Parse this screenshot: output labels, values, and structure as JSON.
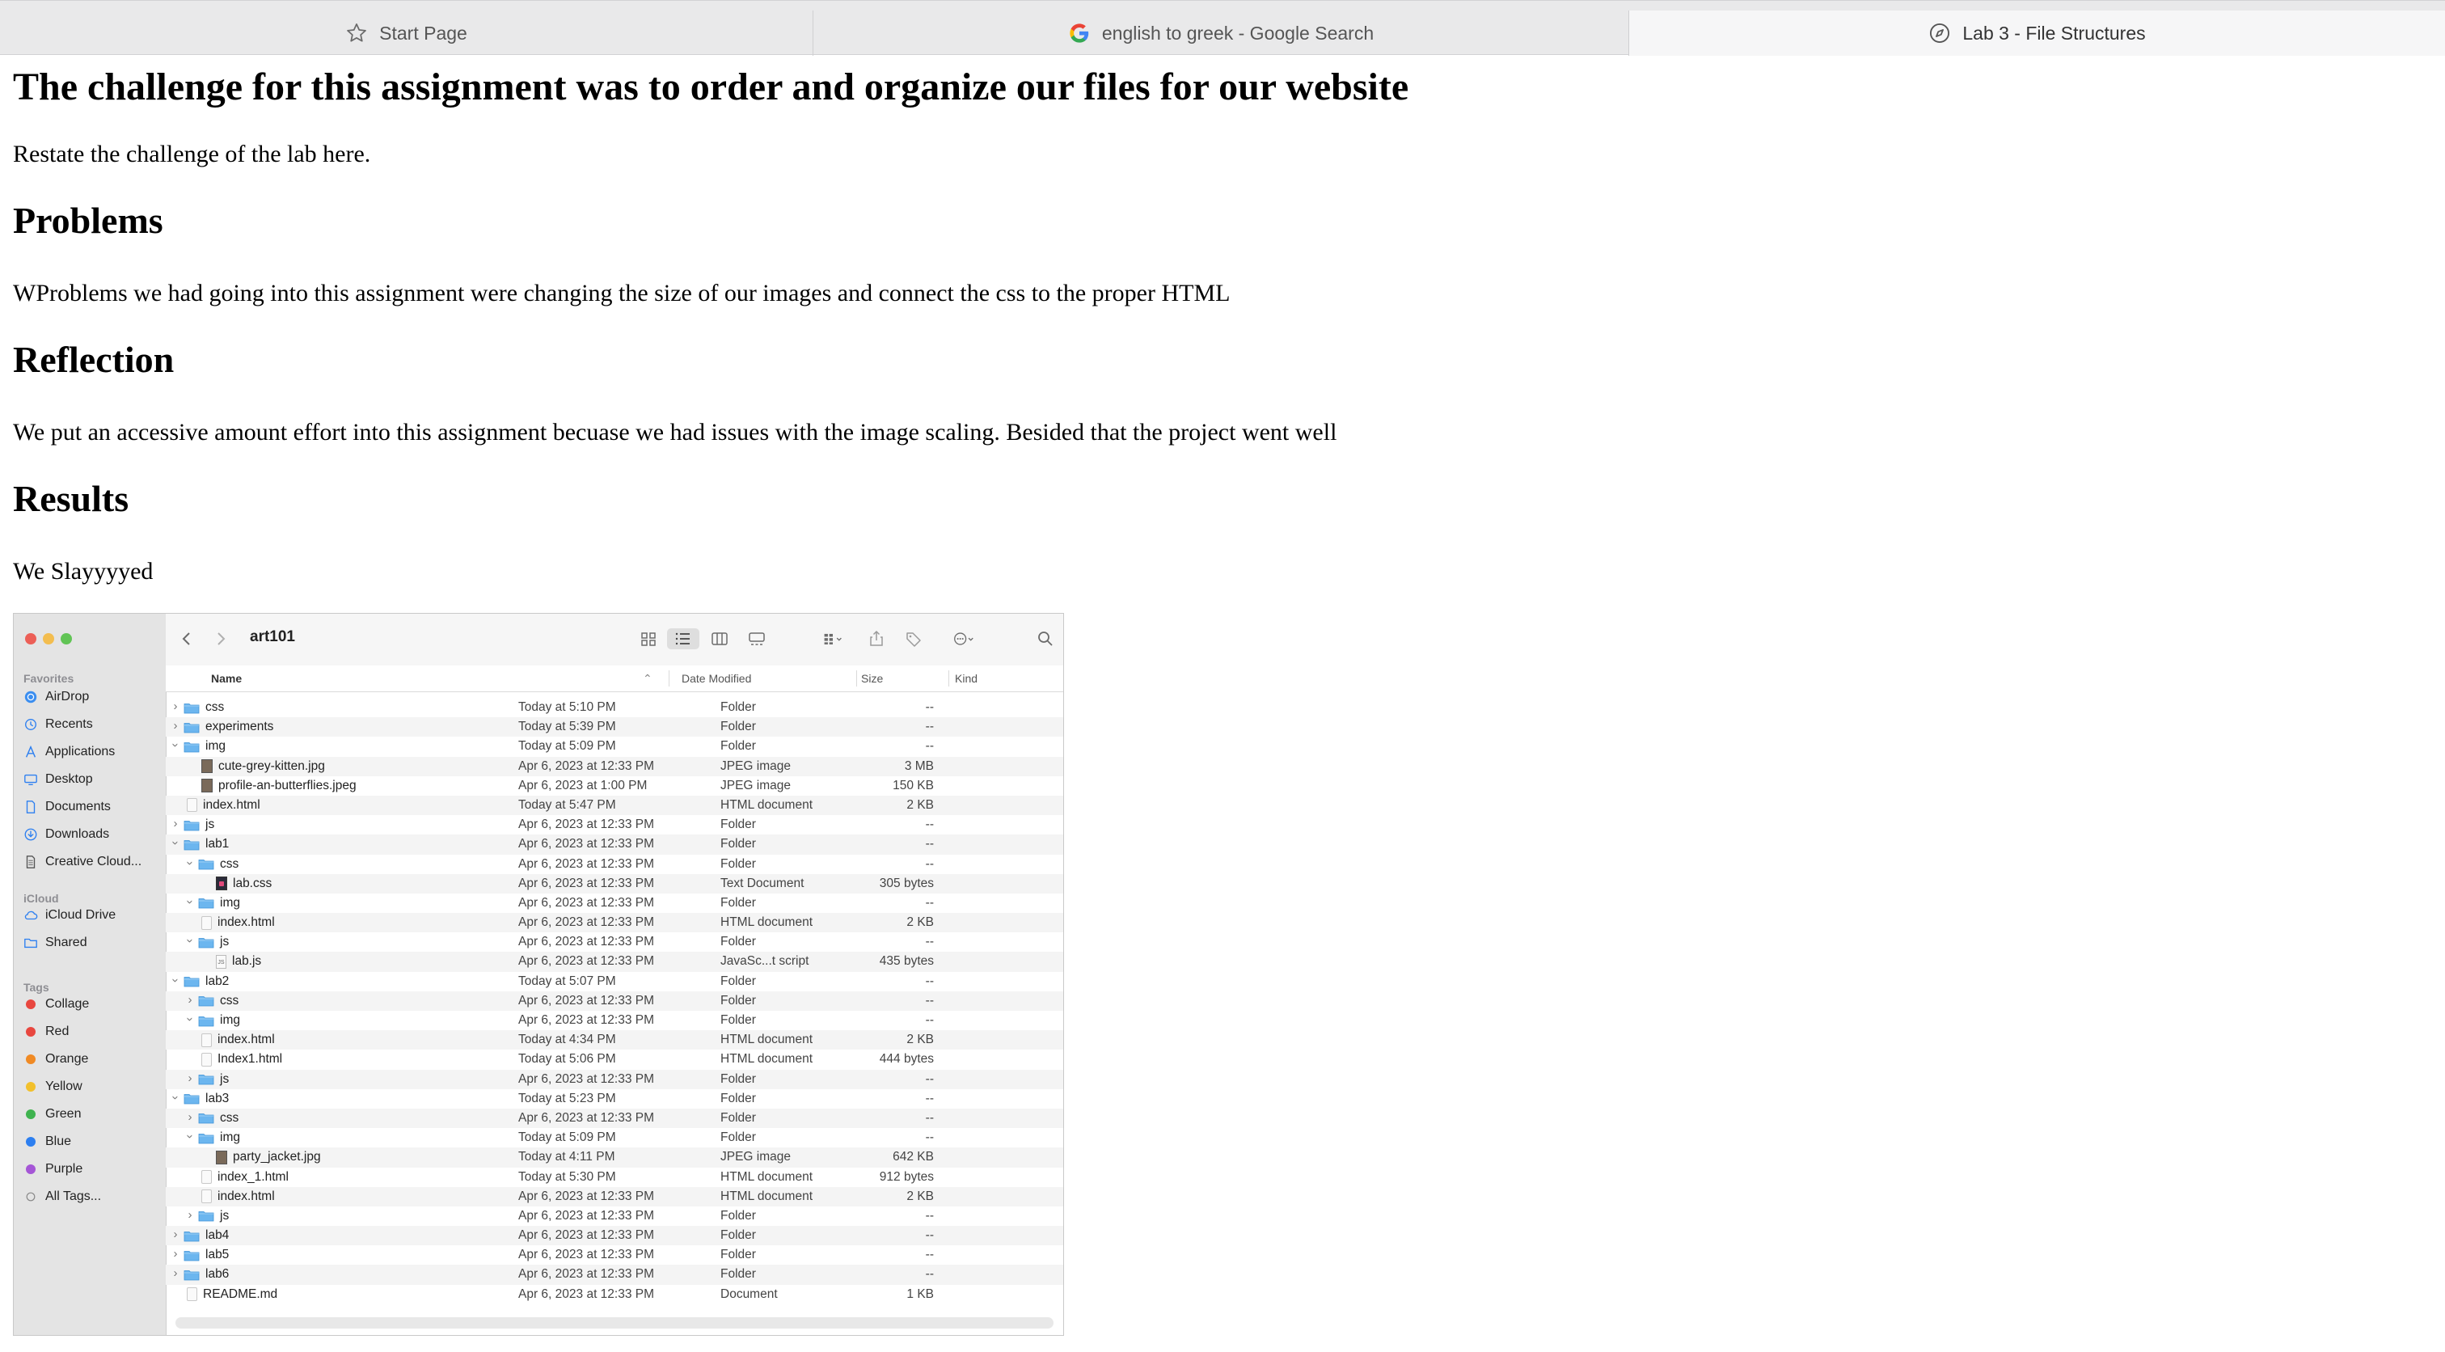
{
  "browser": {
    "tabs": [
      {
        "label": "Start Page",
        "icon": "star-icon"
      },
      {
        "label": "english to greek - Google Search",
        "icon": "google-icon"
      },
      {
        "label": "Lab 3 - File Structures",
        "icon": "compass-icon"
      }
    ]
  },
  "document": {
    "heading": "The challenge for this assignment was to order and organize our files for our website",
    "intro": "Restate the challenge of the lab here.",
    "problems_heading": "Problems",
    "problems_text": "WProblems we had going into this assignment were changing the size of our images and connect the css to the proper HTML",
    "reflection_heading": "Reflection",
    "reflection_text": "We put an accessive amount effort into this assignment becuase we had issues with the image scaling. Besided that the project went well",
    "results_heading": "Results",
    "results_text": "We Slayyyyed"
  },
  "finder": {
    "title": "art101",
    "sidebar": {
      "favorites_label": "Favorites",
      "favorites": [
        {
          "label": "AirDrop",
          "icon": "airdrop-icon"
        },
        {
          "label": "Recents",
          "icon": "clock-icon"
        },
        {
          "label": "Applications",
          "icon": "applications-icon"
        },
        {
          "label": "Desktop",
          "icon": "desktop-icon"
        },
        {
          "label": "Documents",
          "icon": "document-icon"
        },
        {
          "label": "Downloads",
          "icon": "download-icon"
        },
        {
          "label": "Creative Cloud...",
          "icon": "file-icon"
        }
      ],
      "icloud_label": "iCloud",
      "icloud": [
        {
          "label": "iCloud Drive",
          "icon": "cloud-icon"
        },
        {
          "label": "Shared",
          "icon": "shared-folder-icon"
        }
      ],
      "tags_label": "Tags",
      "tags": [
        {
          "label": "Collage",
          "color": "#e8473f"
        },
        {
          "label": "Red",
          "color": "#e8473f"
        },
        {
          "label": "Orange",
          "color": "#f08a24"
        },
        {
          "label": "Yellow",
          "color": "#f2c02c"
        },
        {
          "label": "Green",
          "color": "#3fb34f"
        },
        {
          "label": "Blue",
          "color": "#2d7ff0"
        },
        {
          "label": "Purple",
          "color": "#a556d6"
        },
        {
          "label": "All Tags...",
          "color": ""
        }
      ]
    },
    "columns": {
      "name": "Name",
      "date": "Date Modified",
      "size": "Size",
      "kind": "Kind"
    },
    "rows": [
      {
        "name": "css",
        "depth": 0,
        "type": "folder",
        "exp": "closed",
        "date": "Today at 5:10 PM",
        "size": "--",
        "kind": "Folder"
      },
      {
        "name": "experiments",
        "depth": 0,
        "type": "folder",
        "exp": "closed",
        "date": "Today at 5:39 PM",
        "size": "--",
        "kind": "Folder"
      },
      {
        "name": "img",
        "depth": 0,
        "type": "folder",
        "exp": "open",
        "date": "Today at 5:09 PM",
        "size": "--",
        "kind": "Folder"
      },
      {
        "name": "cute-grey-kitten.jpg",
        "depth": 1,
        "type": "image",
        "exp": "",
        "date": "Apr 6, 2023 at 12:33 PM",
        "size": "3 MB",
        "kind": "JPEG image"
      },
      {
        "name": "profile-an-butterflies.jpeg",
        "depth": 1,
        "type": "image",
        "exp": "",
        "date": "Apr 6, 2023 at 1:00 PM",
        "size": "150 KB",
        "kind": "JPEG image"
      },
      {
        "name": "index.html",
        "depth": 0,
        "type": "file",
        "exp": "",
        "date": "Today at 5:47 PM",
        "size": "2 KB",
        "kind": "HTML document"
      },
      {
        "name": "js",
        "depth": 0,
        "type": "folder",
        "exp": "closed",
        "date": "Apr 6, 2023 at 12:33 PM",
        "size": "--",
        "kind": "Folder"
      },
      {
        "name": "lab1",
        "depth": 0,
        "type": "folder",
        "exp": "open",
        "date": "Apr 6, 2023 at 12:33 PM",
        "size": "--",
        "kind": "Folder"
      },
      {
        "name": "css",
        "depth": 1,
        "type": "folder",
        "exp": "open",
        "date": "Apr 6, 2023 at 12:33 PM",
        "size": "--",
        "kind": "Folder"
      },
      {
        "name": "lab.css",
        "depth": 2,
        "type": "css",
        "exp": "",
        "date": "Apr 6, 2023 at 12:33 PM",
        "size": "305 bytes",
        "kind": "Text Document"
      },
      {
        "name": "img",
        "depth": 1,
        "type": "folder",
        "exp": "open",
        "date": "Apr 6, 2023 at 12:33 PM",
        "size": "--",
        "kind": "Folder"
      },
      {
        "name": "index.html",
        "depth": 1,
        "type": "file",
        "exp": "",
        "date": "Apr 6, 2023 at 12:33 PM",
        "size": "2 KB",
        "kind": "HTML document"
      },
      {
        "name": "js",
        "depth": 1,
        "type": "folder",
        "exp": "open",
        "date": "Apr 6, 2023 at 12:33 PM",
        "size": "--",
        "kind": "Folder"
      },
      {
        "name": "lab.js",
        "depth": 2,
        "type": "js",
        "exp": "",
        "date": "Apr 6, 2023 at 12:33 PM",
        "size": "435 bytes",
        "kind": "JavaSc...t script"
      },
      {
        "name": "lab2",
        "depth": 0,
        "type": "folder",
        "exp": "open",
        "date": "Today at 5:07 PM",
        "size": "--",
        "kind": "Folder"
      },
      {
        "name": "css",
        "depth": 1,
        "type": "folder",
        "exp": "closed",
        "date": "Apr 6, 2023 at 12:33 PM",
        "size": "--",
        "kind": "Folder"
      },
      {
        "name": "img",
        "depth": 1,
        "type": "folder",
        "exp": "open",
        "date": "Apr 6, 2023 at 12:33 PM",
        "size": "--",
        "kind": "Folder"
      },
      {
        "name": "index.html",
        "depth": 1,
        "type": "file",
        "exp": "",
        "date": "Today at 4:34 PM",
        "size": "2 KB",
        "kind": "HTML document"
      },
      {
        "name": "Index1.html",
        "depth": 1,
        "type": "file",
        "exp": "",
        "date": "Today at 5:06 PM",
        "size": "444 bytes",
        "kind": "HTML document"
      },
      {
        "name": "js",
        "depth": 1,
        "type": "folder",
        "exp": "closed",
        "date": "Apr 6, 2023 at 12:33 PM",
        "size": "--",
        "kind": "Folder"
      },
      {
        "name": "lab3",
        "depth": 0,
        "type": "folder",
        "exp": "open",
        "date": "Today at 5:23 PM",
        "size": "--",
        "kind": "Folder"
      },
      {
        "name": "css",
        "depth": 1,
        "type": "folder",
        "exp": "closed",
        "date": "Apr 6, 2023 at 12:33 PM",
        "size": "--",
        "kind": "Folder"
      },
      {
        "name": "img",
        "depth": 1,
        "type": "folder",
        "exp": "open",
        "date": "Today at 5:09 PM",
        "size": "--",
        "kind": "Folder"
      },
      {
        "name": "party_jacket.jpg",
        "depth": 2,
        "type": "image",
        "exp": "",
        "date": "Today at 4:11 PM",
        "size": "642 KB",
        "kind": "JPEG image"
      },
      {
        "name": "index_1.html",
        "depth": 1,
        "type": "file",
        "exp": "",
        "date": "Today at 5:30 PM",
        "size": "912 bytes",
        "kind": "HTML document"
      },
      {
        "name": "index.html",
        "depth": 1,
        "type": "file",
        "exp": "",
        "date": "Apr 6, 2023 at 12:33 PM",
        "size": "2 KB",
        "kind": "HTML document"
      },
      {
        "name": "js",
        "depth": 1,
        "type": "folder",
        "exp": "closed",
        "date": "Apr 6, 2023 at 12:33 PM",
        "size": "--",
        "kind": "Folder"
      },
      {
        "name": "lab4",
        "depth": 0,
        "type": "folder",
        "exp": "closed",
        "date": "Apr 6, 2023 at 12:33 PM",
        "size": "--",
        "kind": "Folder"
      },
      {
        "name": "lab5",
        "depth": 0,
        "type": "folder",
        "exp": "closed",
        "date": "Apr 6, 2023 at 12:33 PM",
        "size": "--",
        "kind": "Folder"
      },
      {
        "name": "lab6",
        "depth": 0,
        "type": "folder",
        "exp": "closed",
        "date": "Apr 6, 2023 at 12:33 PM",
        "size": "--",
        "kind": "Folder"
      },
      {
        "name": "README.md",
        "depth": 0,
        "type": "file",
        "exp": "",
        "date": "Apr 6, 2023 at 12:33 PM",
        "size": "1 KB",
        "kind": "Document"
      }
    ]
  }
}
